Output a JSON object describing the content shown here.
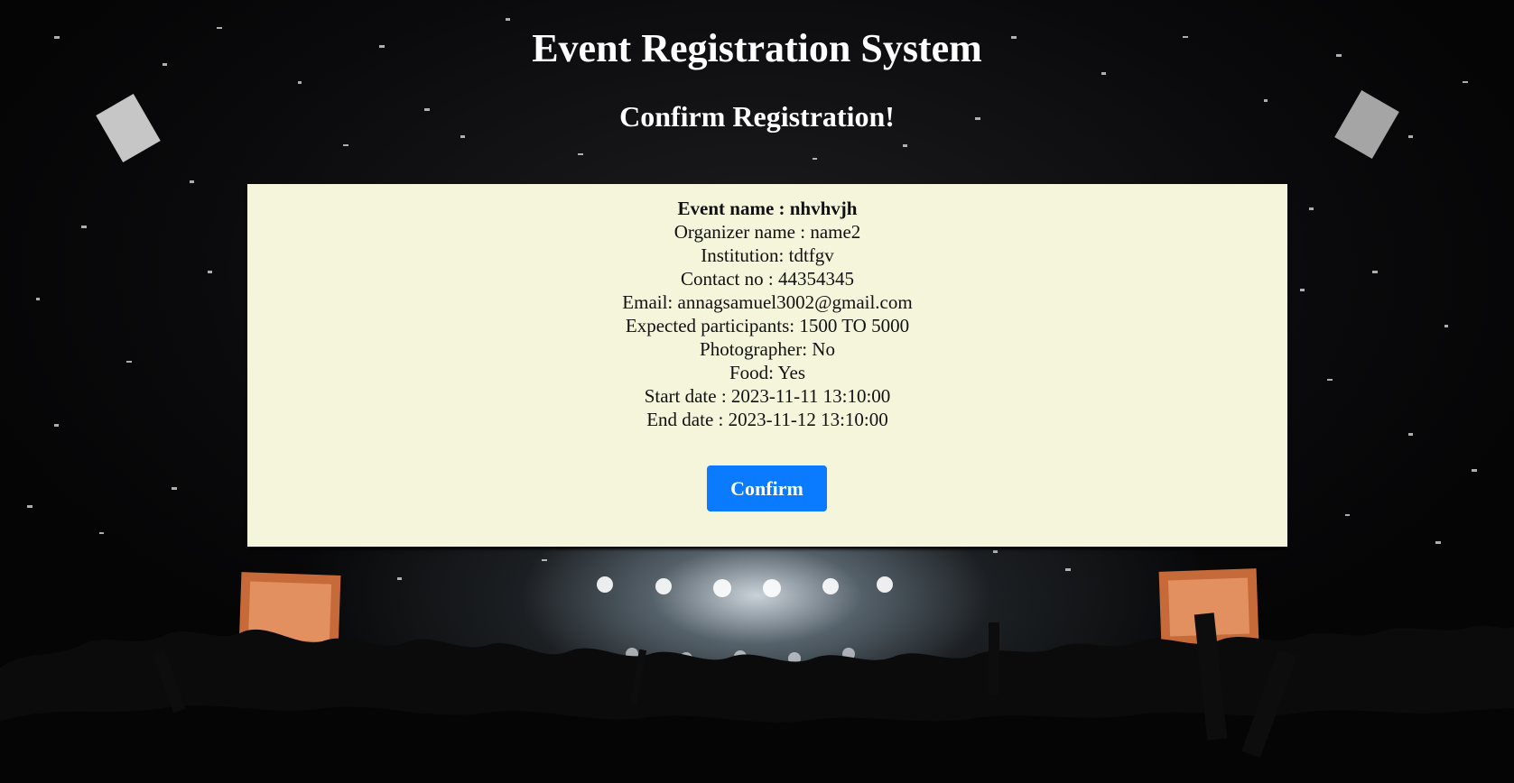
{
  "header": {
    "title": "Event Registration System",
    "subtitle": "Confirm Registration!"
  },
  "details": {
    "event_name": "Event name : nhvhvjh",
    "organizer": "Organizer name : name2",
    "institution": "Institution: tdtfgv",
    "contact": "Contact no : 44354345",
    "email": "Email: annagsamuel3002@gmail.com",
    "participants": "Expected participants: 1500 TO 5000",
    "photographer": "Photographer: No",
    "food": "Food: Yes",
    "start_date": "Start date : 2023-11-11 13:10:00",
    "end_date": "End date : 2023-11-12 13:10:00"
  },
  "actions": {
    "confirm_label": "Confirm"
  },
  "colors": {
    "card_background": "#f5f5dc",
    "button_background": "#0a7bff"
  }
}
